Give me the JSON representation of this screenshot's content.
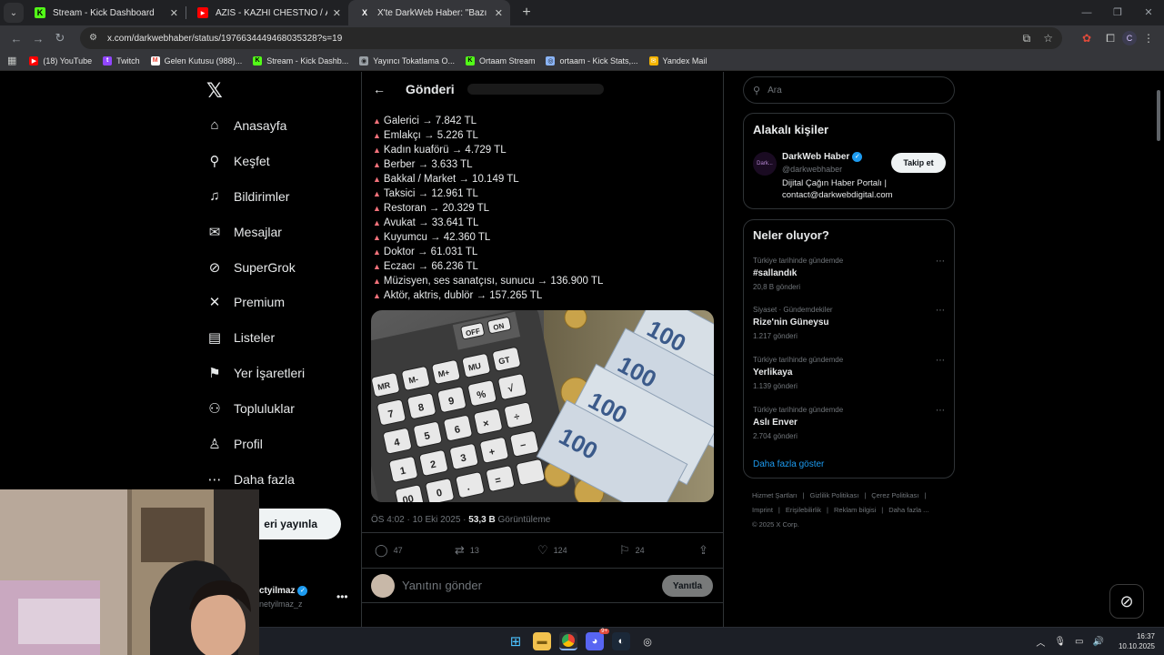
{
  "browser": {
    "tabs": [
      {
        "label": "Stream - Kick Dashboard",
        "fav": "K",
        "fav_color": "#53fc18",
        "active": false
      },
      {
        "label": "AZIS - KAZHI CHESTNO / АЗИС",
        "fav": "▶",
        "fav_color": "#ff0000",
        "active": false
      },
      {
        "label": "X'te DarkWeb Haber: \"Bazı mes",
        "fav": "X",
        "fav_color": "#000000",
        "active": true
      }
    ],
    "url": "x.com/darkwebhaber/status/1976634449468035328?s=19",
    "profile_letter": "C",
    "bookmarks": [
      {
        "label": "(18) YouTube",
        "fav": "▶",
        "color": "#ff0000"
      },
      {
        "label": "Twitch",
        "fav": "t",
        "color": "#9146ff"
      },
      {
        "label": "Gelen Kutusu (988)...",
        "fav": "M",
        "color": "#ea4335"
      },
      {
        "label": "Stream - Kick Dashb...",
        "fav": "K",
        "color": "#53fc18"
      },
      {
        "label": "Yayıncı Tokatlama O...",
        "fav": "◉",
        "color": "#9aa0a6"
      },
      {
        "label": "Ortaam Stream",
        "fav": "K",
        "color": "#53fc18"
      },
      {
        "label": "ortaam - Kick Stats,...",
        "fav": "◎",
        "color": "#8ab4f8"
      },
      {
        "label": "Yandex Mail",
        "fav": "✉",
        "color": "#f4b400"
      }
    ]
  },
  "nav": {
    "items": [
      {
        "label": "Anasayfa",
        "icon": "⌂"
      },
      {
        "label": "Keşfet",
        "icon": "⚲"
      },
      {
        "label": "Bildirimler",
        "icon": "♫"
      },
      {
        "label": "Mesajlar",
        "icon": "✉"
      },
      {
        "label": "SuperGrok",
        "icon": "⊘"
      },
      {
        "label": "Premium",
        "icon": "✕"
      },
      {
        "label": "Listeler",
        "icon": "▤"
      },
      {
        "label": "Yer İşaretleri",
        "icon": "⚑"
      },
      {
        "label": "Topluluklar",
        "icon": "⚇"
      },
      {
        "label": "Profil",
        "icon": "♙"
      },
      {
        "label": "Daha fazla",
        "icon": "⋯"
      }
    ],
    "post_button": "eri yayınla",
    "account_name": "ctyilmaz",
    "account_handle": "netyilmaz_z"
  },
  "post": {
    "header": "Gönderi",
    "lines": [
      "Galerici → 7.842 TL",
      "Emlakçı → 5.226 TL",
      "Kadın kuaförü → 4.729 TL",
      "Berber → 3.633 TL",
      "Bakkal / Market → 10.149 TL",
      "Taksici → 12.961 TL",
      "Restoran → 20.329 TL",
      "Avukat → 33.641 TL",
      "Kuyumcu → 42.360 TL",
      "Doktor → 61.031 TL",
      "Eczacı → 66.236 TL",
      "Müzisyen, ses sanatçısı, sunucu → 136.900 TL",
      "Aktör, aktris, dublör → 157.265 TL"
    ],
    "time": "ÖS 4:02 · 10 Eki 2025 · ",
    "views": "53,3 B",
    "views_label": " Görüntüleme",
    "replies": "47",
    "reposts": "13",
    "likes": "124",
    "bookmarks": "24",
    "reply_placeholder": "Yanıtını gönder",
    "reply_button": "Yanıtla"
  },
  "sidebar": {
    "search_placeholder": "Ara",
    "people_title": "Alakalı kişiler",
    "person": {
      "name": "DarkWeb Haber",
      "handle": "@darkwebhaber",
      "bio": "Dijital Çağın Haber Portalı | contact@darkwebdigital.com",
      "follow": "Takip et",
      "avatar_text": "Dark..."
    },
    "trends_title": "Neler oluyor?",
    "trends": [
      {
        "category": "Türkiye tarihinde gündemde",
        "name": "#sallandık",
        "count": "20,8 B gönderi"
      },
      {
        "category": "Siyaset · Gündemdekiler",
        "name": "Rize'nin Güneysu",
        "count": "1.217 gönderi"
      },
      {
        "category": "Türkiye tarihinde gündemde",
        "name": "Yerlikaya",
        "count": "1.139 gönderi"
      },
      {
        "category": "Türkiye tarihinde gündemde",
        "name": "Aslı Enver",
        "count": "2.704 gönderi"
      }
    ],
    "show_more": "Daha fazla göster",
    "footer": [
      "Hizmet Şartları",
      "|",
      "Gizlilik Politikası",
      "|",
      "Çerez Politikası",
      "|",
      "Imprint",
      "|",
      "Erişilebilirlik",
      "|",
      "Reklam bilgisi",
      "|",
      "Daha fazla ...",
      "© 2025 X Corp."
    ]
  },
  "taskbar": {
    "time": "16:37",
    "date": "10.10.2025",
    "notification_badge": "9+"
  },
  "colors": {
    "accent": "#1d9bf0",
    "triangle": "#f4727b",
    "kick_green": "#53fc18"
  }
}
